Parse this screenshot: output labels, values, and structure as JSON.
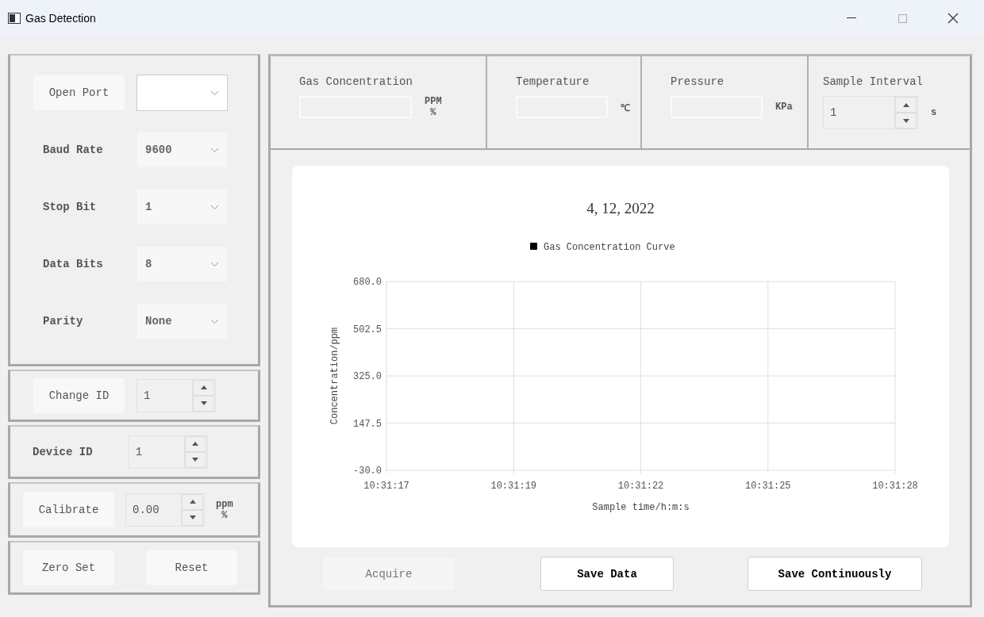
{
  "window": {
    "title": "Gas Detection"
  },
  "serial": {
    "port_button": "Open Port",
    "settings": [
      {
        "label": "Baud Rate",
        "value": "9600",
        "disabled": true
      },
      {
        "label": "Stop Bit",
        "value": "1",
        "disabled": true
      },
      {
        "label": "Data Bits",
        "value": "8",
        "disabled": true
      },
      {
        "label": "Parity",
        "value": "None",
        "disabled": true
      }
    ]
  },
  "change_id": {
    "button": "Change ID",
    "value": "1"
  },
  "device_id": {
    "label": "Device ID",
    "value": "1"
  },
  "calibrate": {
    "button": "Calibrate",
    "value": "0.00",
    "units": [
      "ppm",
      "%"
    ]
  },
  "actions": [
    "Zero Set",
    "Reset"
  ],
  "readouts": [
    {
      "kind": "field",
      "title": "Gas Concentration",
      "units": [
        "PPM",
        "%"
      ]
    },
    {
      "kind": "field",
      "title": "Temperature",
      "units": [
        "℃"
      ]
    },
    {
      "kind": "field",
      "title": "Pressure",
      "units": [
        "KPa"
      ]
    },
    {
      "kind": "spin",
      "title": "Sample Interval",
      "value": "1",
      "units": [
        "s"
      ]
    }
  ],
  "chart": {
    "chart_data": {
      "type": "line",
      "title": "4, 12, 2022",
      "xlabel": "Sample time/h:m:s",
      "ylabel": "Concentration/ppm",
      "categories": [
        "10:31:17",
        "10:31:19",
        "10:31:22",
        "10:31:25",
        "10:31:28"
      ],
      "series": [
        {
          "name": "Gas Concentration Curve",
          "color": "#000000",
          "values": [
            null,
            null,
            null,
            null,
            null
          ]
        }
      ],
      "ylim": [
        -30,
        680
      ],
      "grid": true,
      "yticks": [
        {
          "value": -30,
          "label": "-30.0"
        },
        {
          "value": 147.5,
          "label": "147.5"
        },
        {
          "value": 325,
          "label": "325.0"
        },
        {
          "value": 502.5,
          "label": "502.5"
        },
        {
          "value": 680,
          "label": "680.0"
        }
      ]
    }
  },
  "buttons": [
    {
      "label": "Acquire",
      "disabled": true,
      "bold": false
    },
    {
      "label": "Save Data",
      "disabled": false,
      "bold": true
    },
    {
      "label": "Save Continuously",
      "disabled": false,
      "bold": true
    }
  ]
}
